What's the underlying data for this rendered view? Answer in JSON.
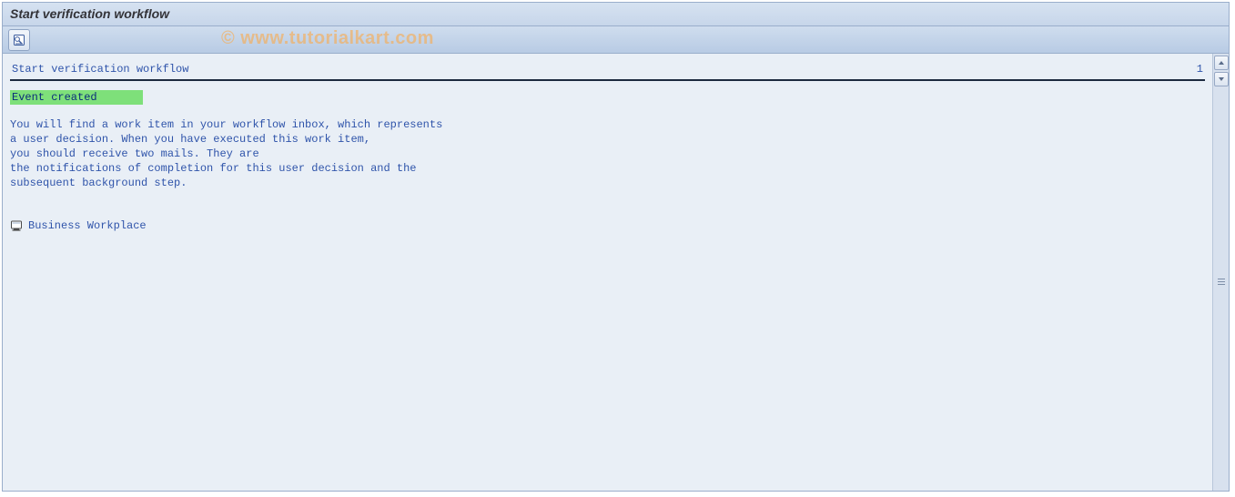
{
  "window": {
    "title": "Start verification workflow"
  },
  "toolbar": {
    "details_icon": "details-icon"
  },
  "watermark": "© www.tutorialkart.com",
  "list": {
    "heading": "Start verification workflow",
    "count": "1"
  },
  "status": {
    "label": "Event created"
  },
  "body": {
    "line1": "You will find a work item in your workflow inbox, which represents",
    "line2": "a user decision. When you have executed this work item,",
    "line3": "you should receive two mails. They are",
    "line4": "the notifications of completion for this user decision and the",
    "line5": "subsequent background step."
  },
  "link": {
    "label": "Business Workplace"
  }
}
